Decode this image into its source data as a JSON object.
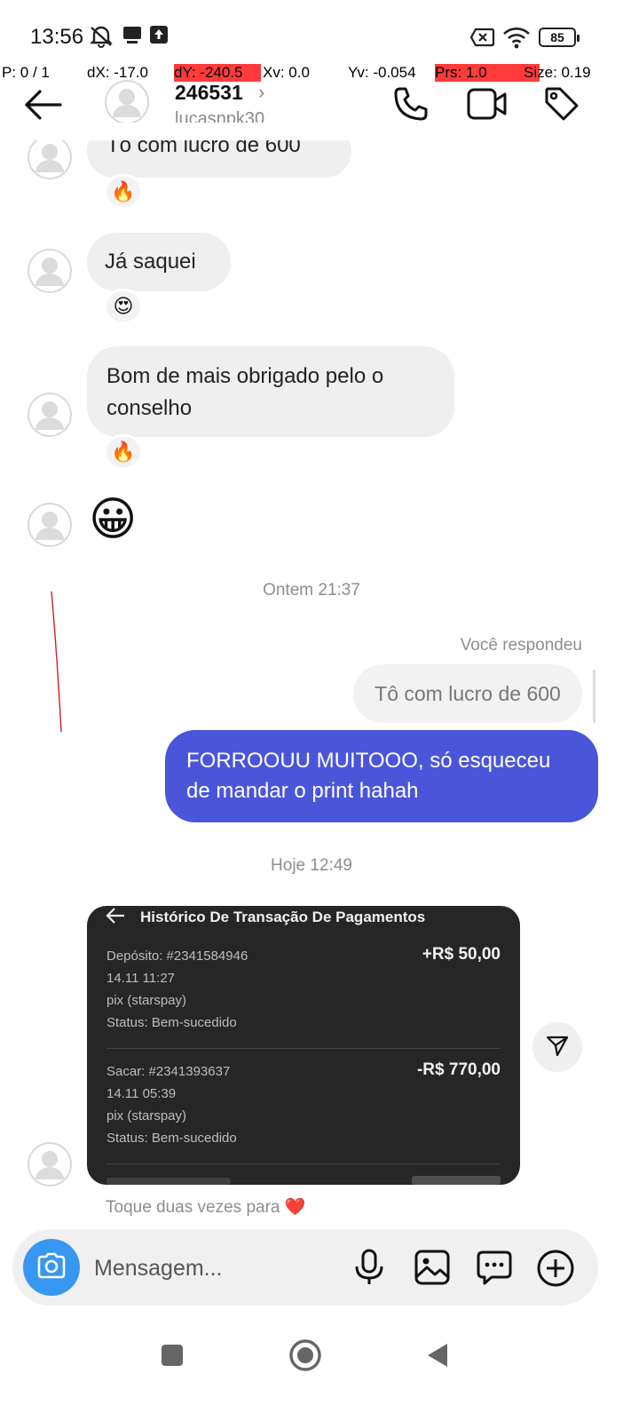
{
  "status_bar": {
    "time": "13:56",
    "battery": "85"
  },
  "debug_overlay": {
    "p": "P: 0 / 1",
    "dx": "dX: -17.0",
    "dy": "dY: -240.5",
    "xv": "Xv: 0.0",
    "yv": "Yv: -0.054",
    "prs": "Prs: 1.0",
    "size": "Size: 0.19"
  },
  "header": {
    "name": "246531",
    "chevron": "›",
    "username": "lucasnpk30",
    "icons": [
      "back-arrow-icon",
      "phone-icon",
      "video-call-icon",
      "tag-icon"
    ]
  },
  "messages": {
    "partial_top": "Tô com lucro de 600",
    "partial_reaction": "🔥",
    "msg_saquei": "Já saquei",
    "reaction_saquei": "😍",
    "msg_bom_line1": "Bom de mais obrigado pelo o",
    "msg_bom_line2": "conselho",
    "reaction_bom": "🔥",
    "emoji_msg": "😀",
    "timestamp_1": "Ontem 21:37",
    "reply_label": "Você respondeu",
    "reply_quote": "Tô com lucro de 600",
    "sent_line1": "FORROOUU MUITOOO, só esqueceu",
    "sent_line2": "de mandar o print hahah",
    "timestamp_2": "Hoje 12:49",
    "double_tap_hint": "Toque duas vezes para ❤️"
  },
  "transaction_card": {
    "title": "Histórico De Transação De Pagamentos",
    "rows": [
      {
        "id": "Depósito: #2341584946",
        "datetime": "14.11 11:27",
        "method": "pix (starspay)",
        "status": "Status: Bem-sucedido",
        "amount": "+R$ 50,00"
      },
      {
        "id": "Sacar: #2341393637",
        "datetime": "14.11 05:39",
        "method": "pix (starspay)",
        "status": "Status: Bem-sucedido",
        "amount": "-R$ 770,00"
      }
    ]
  },
  "composer": {
    "placeholder": "Mensagem...",
    "icons": [
      "camera-icon",
      "microphone-icon",
      "gallery-icon",
      "sticker-icon",
      "add-icon"
    ]
  },
  "colors": {
    "sent_bubble": "#4b55d9",
    "received_bubble": "#efefef",
    "camera_button": "#3897f0",
    "card_bg": "#262626",
    "debug_highlight": "#ff3b3b"
  }
}
